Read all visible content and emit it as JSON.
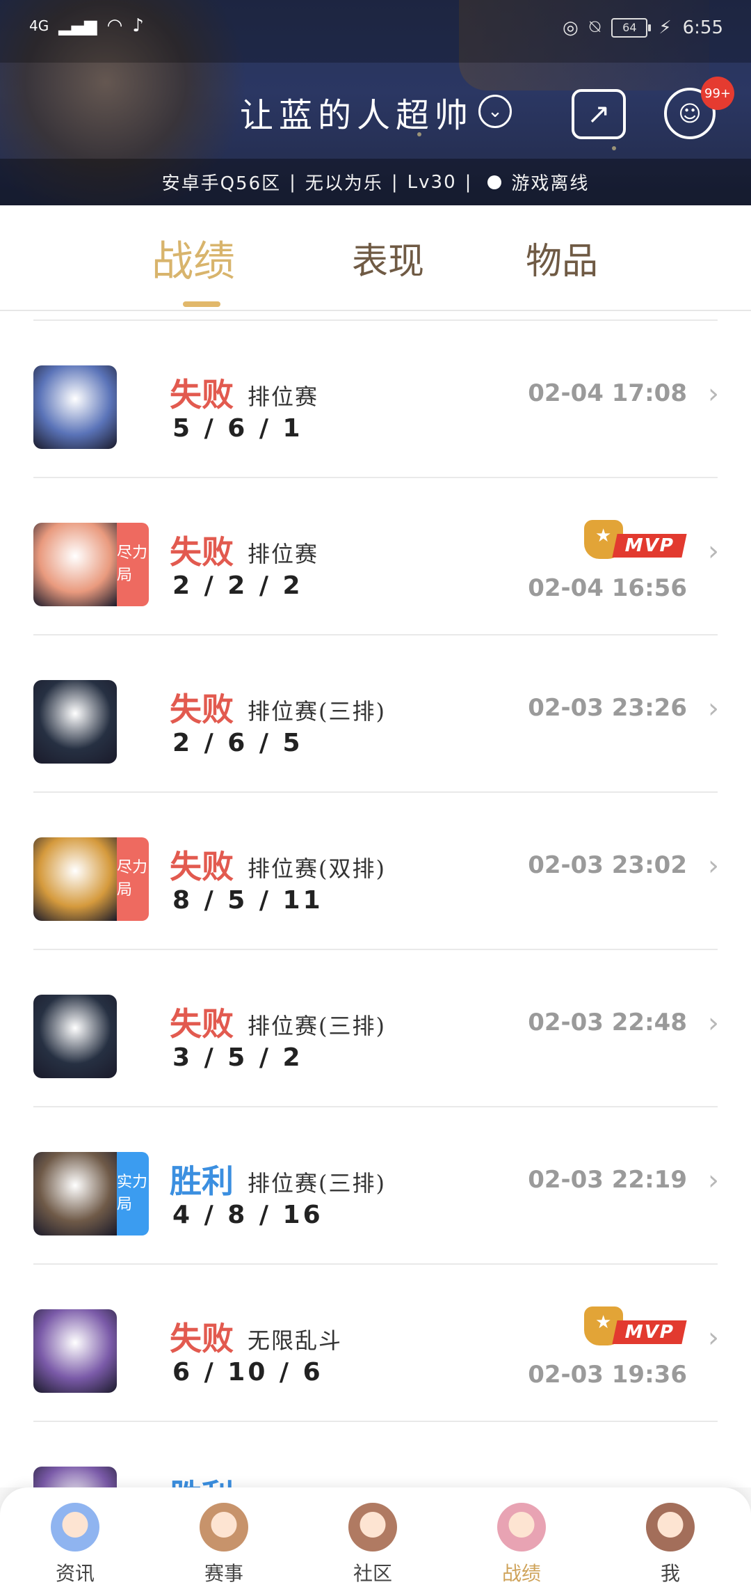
{
  "status_bar": {
    "network": "4G",
    "battery": "64",
    "time": "6:55"
  },
  "header": {
    "player_name": "让蓝的人超帅",
    "message_badge": "99+",
    "info": {
      "server": "安卓手Q56区",
      "title": "无以为乐",
      "level": "Lv30",
      "status": "游戏离线"
    }
  },
  "tabs": [
    {
      "label": "战绩"
    },
    {
      "label": "表现"
    },
    {
      "label": "物品"
    }
  ],
  "matches": [
    {
      "result": "失败",
      "mode": "排位赛",
      "kda": "5 / 6 / 1",
      "time": "02-04 17:08",
      "mvp": false,
      "tag": "",
      "avatar_color": "#5a73b8",
      "result_color": "#e25a4f"
    },
    {
      "result": "失败",
      "mode": "排位赛",
      "kda": "2 / 2 / 2",
      "time": "02-04 16:56",
      "mvp": true,
      "mvp_label": "MVP",
      "tag": "尽力局",
      "tag_color": "#ee6a60",
      "avatar_color": "#e99a7e",
      "result_color": "#e25a4f"
    },
    {
      "result": "失败",
      "mode": "排位赛(三排)",
      "kda": "2 / 6 / 5",
      "time": "02-03 23:26",
      "mvp": false,
      "tag": "",
      "avatar_color": "#263042",
      "result_color": "#e25a4f"
    },
    {
      "result": "失败",
      "mode": "排位赛(双排)",
      "kda": "8 / 5 / 11",
      "time": "02-03 23:02",
      "mvp": false,
      "tag": "尽力局",
      "tag_color": "#ee6a60",
      "avatar_color": "#d59a3d",
      "result_color": "#e25a4f"
    },
    {
      "result": "失败",
      "mode": "排位赛(三排)",
      "kda": "3 / 5 / 2",
      "time": "02-03 22:48",
      "mvp": false,
      "tag": "",
      "avatar_color": "#263042",
      "result_color": "#e25a4f"
    },
    {
      "result": "胜利",
      "mode": "排位赛(三排)",
      "kda": "4 / 8 / 16",
      "time": "02-03 22:19",
      "mvp": false,
      "tag": "实力局",
      "tag_color": "#3b9cf0",
      "avatar_color": "#6f5a48",
      "result_color": "#3b8fe0"
    },
    {
      "result": "失败",
      "mode": "无限乱斗",
      "kda": "6 / 10 / 6",
      "time": "02-03 19:36",
      "mvp": true,
      "mvp_label": "MVP",
      "tag": "",
      "avatar_color": "#7a5aa8",
      "result_color": "#e25a4f"
    },
    {
      "result": "胜利",
      "mode": "",
      "kda": "",
      "time": "",
      "mvp": false,
      "tag": "",
      "avatar_color": "#7a5aa8",
      "result_color": "#3b8fe0"
    }
  ],
  "nav": [
    {
      "label": "资讯",
      "icon": "news-avatar-icon",
      "color": "#8fb4f0"
    },
    {
      "label": "赛事",
      "icon": "events-avatar-icon",
      "color": "#c7936b"
    },
    {
      "label": "社区",
      "icon": "community-avatar-icon",
      "color": "#b07a62"
    },
    {
      "label": "战绩",
      "icon": "record-avatar-icon",
      "color": "#e8a3b3"
    },
    {
      "label": "我",
      "icon": "me-avatar-icon",
      "color": "#a36e5a"
    }
  ],
  "active_nav": "战绩",
  "chevron_glyph": "›"
}
